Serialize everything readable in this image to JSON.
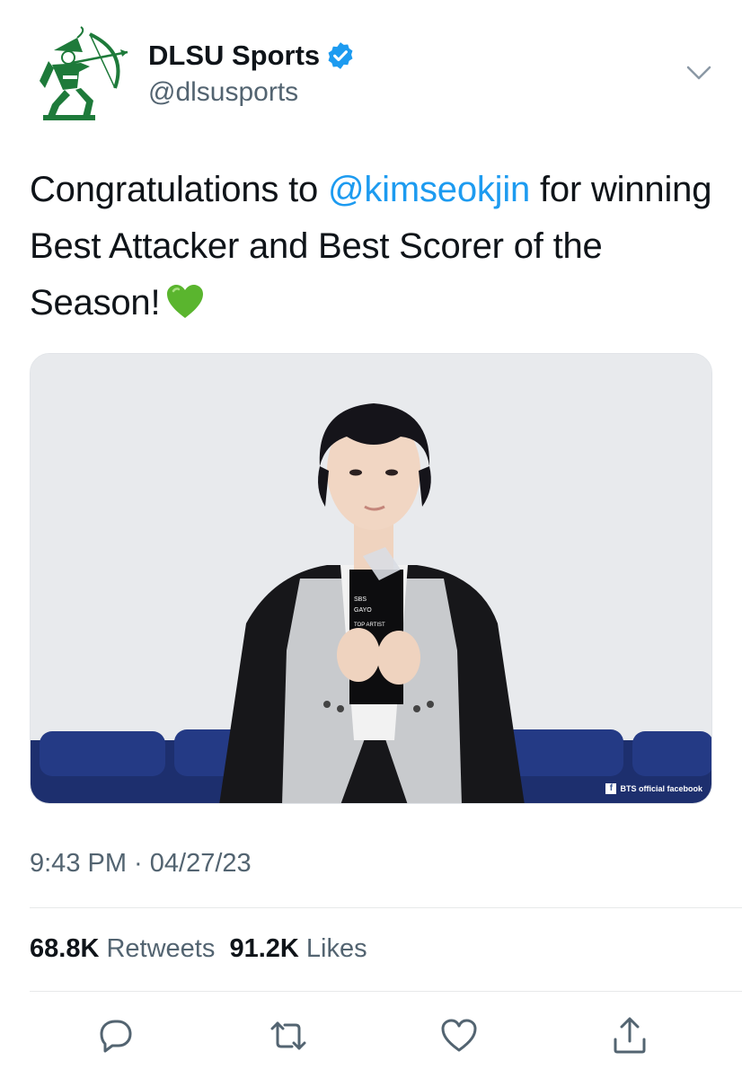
{
  "author": {
    "name": "DLSU Sports",
    "handle": "@dlsusports",
    "verified": true,
    "avatar_icon": "green-archer-logo-icon"
  },
  "tweet": {
    "text_before": "Congratulations to ",
    "mention": "@kimseokjin",
    "text_after": " for winning Best Attacker and Best Scorer of the Season!",
    "emoji": "green-heart-icon",
    "timestamp": "9:43 PM · 04/27/23"
  },
  "photo": {
    "award_lines": [
      "SBS",
      "GAYO",
      "TOP ARTIST"
    ],
    "watermark": "BTS official facebook"
  },
  "stats": {
    "retweets_count": "68.8K",
    "retweets_label": "Retweets",
    "likes_count": "91.2K",
    "likes_label": "Likes"
  },
  "actions": [
    "reply-icon",
    "retweet-icon",
    "like-icon",
    "share-icon"
  ],
  "colors": {
    "accent": "#1d9bf0",
    "secondary_text": "#536471",
    "primary_text": "#0f1419",
    "logo_green": "#1e7a3a"
  }
}
